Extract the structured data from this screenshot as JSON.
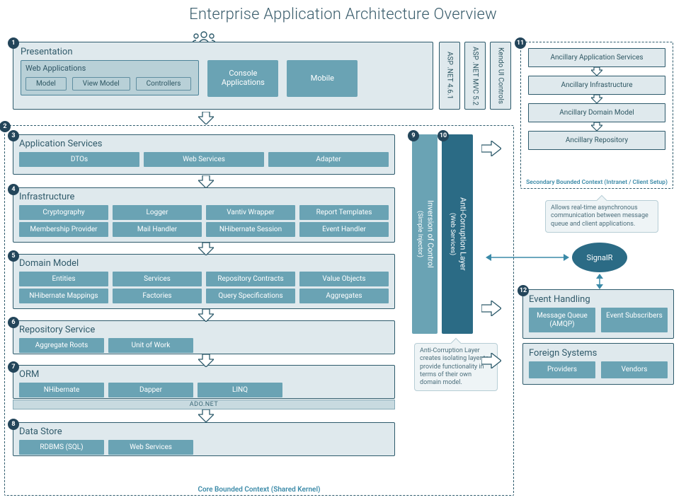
{
  "title": "Enterprise Application Architecture Overview",
  "presentation": {
    "label": "Presentation",
    "webapps": {
      "label": "Web Applications",
      "items": [
        "Model",
        "View Model",
        "Controllers"
      ]
    },
    "console": "Console\nApplications",
    "mobile": "Mobile"
  },
  "tech_cols": [
    "ASP .NET 4.6.1",
    "ASP .NET MVC 5.2",
    "Kendo UI Controls"
  ],
  "layers": {
    "app_services": {
      "label": "Application Services",
      "items": [
        "DTOs",
        "Web Services",
        "Adapter"
      ]
    },
    "infrastructure": {
      "label": "Infrastructure",
      "row1": [
        "Cryptography",
        "Logger",
        "Vantiv Wrapper",
        "Report Templates"
      ],
      "row2": [
        "Membership Provider",
        "Mail Handler",
        "NHibernate Session",
        "Event Handler"
      ]
    },
    "domain": {
      "label": "Domain Model",
      "row1": [
        "Entities",
        "Services",
        "Repository Contracts",
        "Value Objects"
      ],
      "row2": [
        "NHibernate Mappings",
        "Factories",
        "Query Specifications",
        "Aggregates"
      ]
    },
    "repo": {
      "label": "Repository Service",
      "items": [
        "Aggregate Roots",
        "Unit of Work"
      ]
    },
    "orm": {
      "label": "ORM",
      "items": [
        "NHibernate",
        "Dapper",
        "LINQ"
      ]
    },
    "adonet": "ADO.NET",
    "datastore": {
      "label": "Data Store",
      "items": [
        "RDBMS (SQL)",
        "Web Services"
      ]
    }
  },
  "core_ctx_label": "Core Bounded Context (Shared Kernel)",
  "ioc": {
    "label": "Inversion of Control",
    "sub": "(Simple Injector)"
  },
  "acl": {
    "label": "Anti-Corruption Layer",
    "sub": "(Web Services)",
    "tooltip": "Anti-Corruption Layer creates isolating layer to provide functionality in terms of their own domain model."
  },
  "secondary": {
    "items": [
      "Ancillary Application Services",
      "Ancillary Infrastructure",
      "Ancillary Domain Model",
      "Ancillary Repository"
    ],
    "label": "Secondary Bounded Context (Intranet / Client Setup)"
  },
  "signalr": {
    "label": "SignalR",
    "tooltip": "Allows real-time asynchronous communication between message queue and client applications."
  },
  "event_handling": {
    "label": "Event Handling",
    "items": [
      "Message Queue (AMQP)",
      "Event Subscribers"
    ]
  },
  "foreign": {
    "label": "Foreign Systems",
    "items": [
      "Providers",
      "Vendors"
    ]
  },
  "badges": [
    "1",
    "2",
    "3",
    "4",
    "5",
    "6",
    "7",
    "8",
    "9",
    "10",
    "11",
    "12"
  ]
}
